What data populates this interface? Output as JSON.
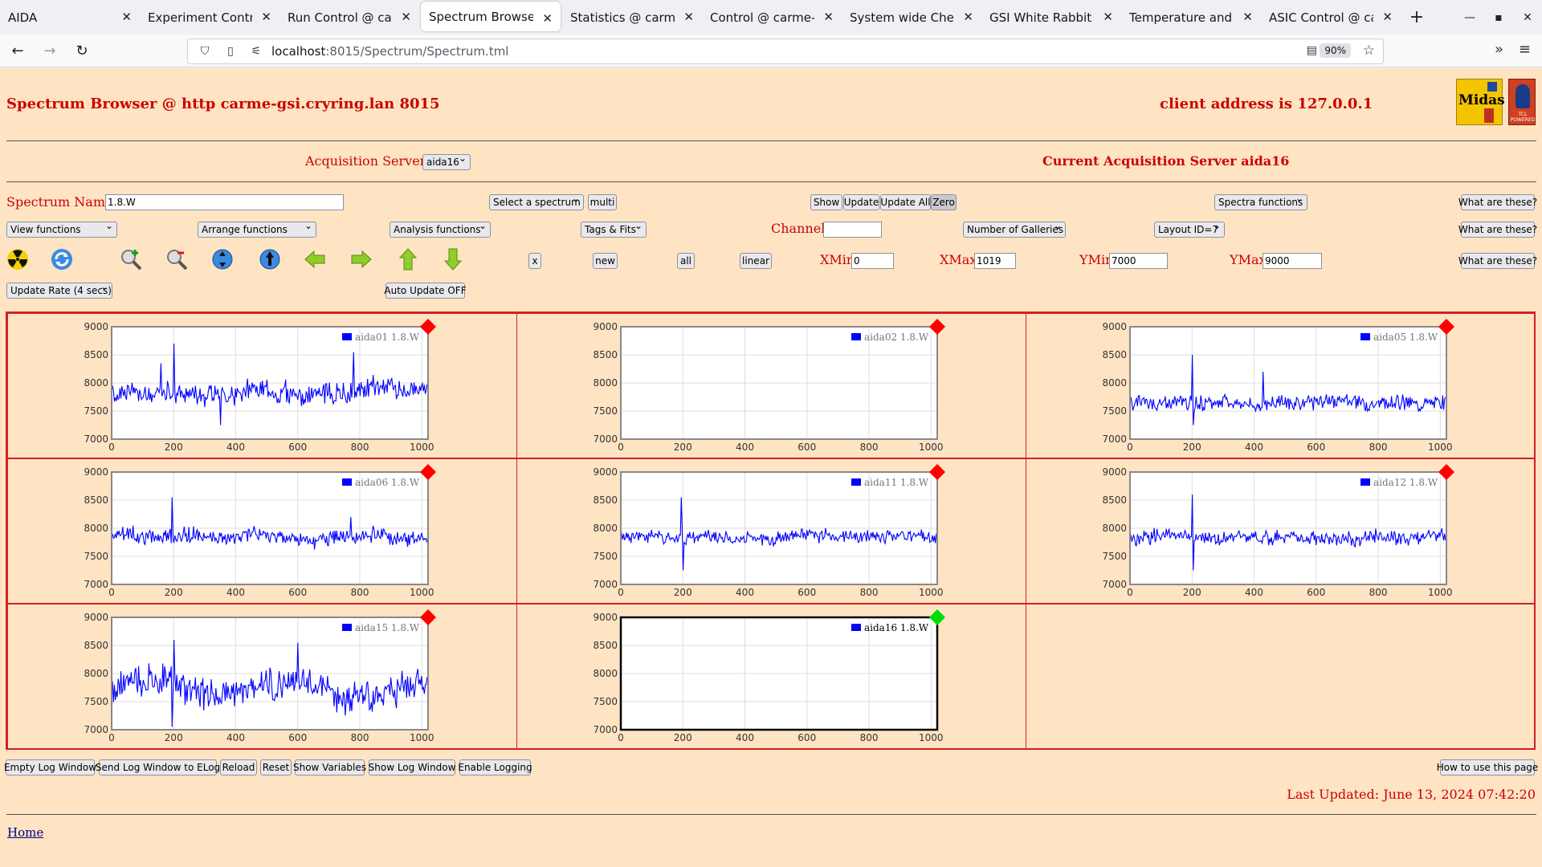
{
  "browser": {
    "tabs": [
      {
        "title": "AIDA",
        "active": false
      },
      {
        "title": "Experiment Control @ carme-gsi",
        "active": false
      },
      {
        "title": "Run Control @ carme-gsi",
        "active": false
      },
      {
        "title": "Spectrum Browser @ http carme-gsi",
        "active": true
      },
      {
        "title": "Statistics @ carme-gsi",
        "active": false
      },
      {
        "title": "Control @ carme-gsi",
        "active": false
      },
      {
        "title": "System wide Checks @ carme-gsi",
        "active": false
      },
      {
        "title": "GSI White Rabbit Timestamp",
        "active": false
      },
      {
        "title": "Temperature and status",
        "active": false
      },
      {
        "title": "ASIC Control @ carme-gsi",
        "active": false
      }
    ],
    "url_host": "localhost",
    "url_rest": ":8015/Spectrum/Spectrum.tml",
    "zoom": "90%"
  },
  "header": {
    "title": "Spectrum Browser @ http carme-gsi.cryring.lan 8015",
    "client_address": "client address is 127.0.0.1",
    "logo_main": "Midas",
    "logo_side": "TCL POWERED"
  },
  "acq": {
    "label": "Acquisition Servers",
    "selected": "aida16",
    "current": "Current Acquisition Server aida16"
  },
  "row1": {
    "spectrum_name_label": "Spectrum Name:",
    "spectrum_name_value": "1.8.W",
    "select_spectrum": "Select a spectrum",
    "multi": "multi",
    "show": "Show",
    "update": "Update",
    "update_all": "Update All",
    "zero": "Zero",
    "spectra_functions": "Spectra functions",
    "what": "What are these?"
  },
  "row2": {
    "view_functions": "View functions",
    "arrange_functions": "Arrange functions",
    "analysis_functions": "Analysis functions",
    "tags_fits": "Tags & Fits",
    "channel_label": "Channel:",
    "channel_value": "",
    "galleries": "Number of Galleries",
    "layout": "Layout ID=7",
    "what": "What are these?"
  },
  "row3": {
    "x_btn": "x",
    "new_btn": "new",
    "all_btn": "all",
    "linear_btn": "linear",
    "xmin_label": "XMin",
    "xmin_value": "0",
    "xmax_label": "XMax",
    "xmax_value": "1019",
    "ymin_label": "YMin",
    "ymin_value": "7000",
    "ymax_label": "YMax",
    "ymax_value": "9000",
    "what": "What are these?"
  },
  "row4": {
    "update_rate": "Update Rate (4 secs)",
    "auto_update": "Auto Update OFF"
  },
  "chart_data": {
    "type": "line",
    "xlim": [
      0,
      1020
    ],
    "ylim": [
      7000,
      9000
    ],
    "xticks": [
      0,
      200,
      400,
      600,
      800,
      1000
    ],
    "yticks": [
      7000,
      7500,
      8000,
      8500,
      9000
    ],
    "grid": true,
    "legend_position": "top-right",
    "series_color": "#0000ff",
    "status_red": "#ff0000",
    "status_green": "#00dd00",
    "panels": [
      {
        "name": "aida01 1.8.W",
        "status": "red",
        "has_data": true,
        "baseline": 7850,
        "noise": 160,
        "selected": false,
        "spikes": [
          {
            "x": 200,
            "y": 8700
          },
          {
            "x": 780,
            "y": 8550
          },
          {
            "x": 160,
            "y": 8350
          },
          {
            "x": 350,
            "y": 7250
          }
        ]
      },
      {
        "name": "aida02 1.8.W",
        "status": "red",
        "has_data": false,
        "baseline": 0,
        "noise": 0,
        "selected": false,
        "spikes": []
      },
      {
        "name": "aida05 1.8.W",
        "status": "red",
        "has_data": true,
        "baseline": 7650,
        "noise": 110,
        "selected": false,
        "spikes": [
          {
            "x": 200,
            "y": 8500
          },
          {
            "x": 205,
            "y": 7250
          },
          {
            "x": 430,
            "y": 8200
          }
        ]
      },
      {
        "name": "aida06 1.8.W",
        "status": "red",
        "has_data": true,
        "baseline": 7850,
        "noise": 120,
        "selected": false,
        "spikes": [
          {
            "x": 195,
            "y": 8550
          },
          {
            "x": 770,
            "y": 8200
          }
        ]
      },
      {
        "name": "aida11 1.8.W",
        "status": "red",
        "has_data": true,
        "baseline": 7850,
        "noise": 100,
        "selected": false,
        "spikes": [
          {
            "x": 195,
            "y": 8550
          },
          {
            "x": 200,
            "y": 7250
          }
        ]
      },
      {
        "name": "aida12 1.8.W",
        "status": "red",
        "has_data": true,
        "baseline": 7850,
        "noise": 110,
        "selected": false,
        "spikes": [
          {
            "x": 200,
            "y": 8600
          },
          {
            "x": 205,
            "y": 7250
          }
        ]
      },
      {
        "name": "aida15 1.8.W",
        "status": "red",
        "has_data": true,
        "baseline": 7750,
        "noise": 230,
        "selected": false,
        "spikes": [
          {
            "x": 200,
            "y": 8600
          },
          {
            "x": 600,
            "y": 8550
          },
          {
            "x": 195,
            "y": 7050
          }
        ]
      },
      {
        "name": "aida16 1.8.W",
        "status": "green",
        "has_data": false,
        "baseline": 0,
        "noise": 0,
        "selected": true,
        "spikes": []
      }
    ]
  },
  "bottom": {
    "buttons": [
      "Empty Log Window",
      "Send Log Window to ELog",
      "Reload",
      "Reset",
      "Show Variables",
      "Show Log Window",
      "Enable Logging"
    ],
    "how_to": "How to use this page",
    "last_updated": "Last Updated: June 13, 2024 07:42:20",
    "home": "Home"
  }
}
